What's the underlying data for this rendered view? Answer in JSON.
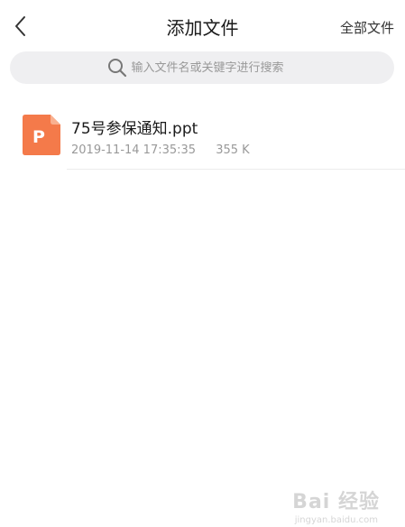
{
  "header": {
    "title": "添加文件",
    "right_action": "全部文件",
    "back_icon": "chevron-left-icon"
  },
  "search": {
    "placeholder": "输入文件名或关键字进行搜索",
    "value": "",
    "icon": "search-icon"
  },
  "files": [
    {
      "name": "75号参保通知.ppt",
      "date": "2019-11-14 17:35:35",
      "size": "355 K",
      "icon_letter": "P",
      "icon_color": "#f47a4a"
    }
  ],
  "watermark": {
    "brand": "Bai 经验",
    "url": "jingyan.baidu.com"
  },
  "colors": {
    "search_bg": "#efeff1",
    "ppt_icon": "#f47a4a"
  }
}
